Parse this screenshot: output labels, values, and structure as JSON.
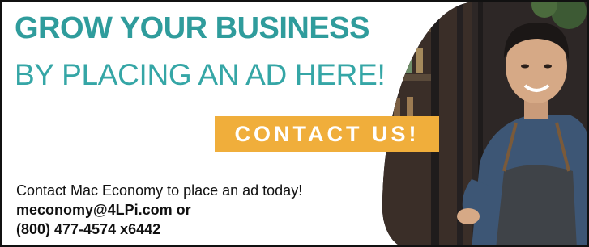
{
  "ad": {
    "headline_line1": "GROW YOUR BUSINESS",
    "headline_line2": "BY PLACING AN AD HERE!",
    "cta_label": "CONTACT US!",
    "body_line1": "Contact Mac Economy to place an ad today!",
    "email_line": "meconomy@4LPi.com or",
    "phone_line": "(800) 477-4574 x6442"
  },
  "colors": {
    "headline_teal": "#2f9c9c",
    "cta_orange": "#f0ae3b",
    "text_dark": "#111111"
  }
}
